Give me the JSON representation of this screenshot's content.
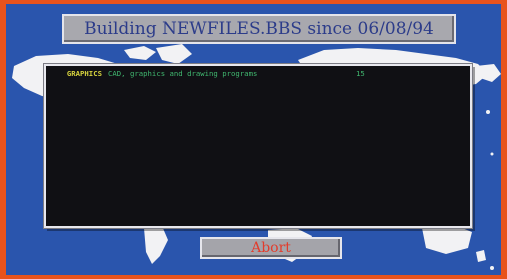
{
  "title": "Building NEWFILES.BBS since 06/08/94",
  "abort_label": "Abort",
  "colors": {
    "border": "#e8531c",
    "background": "#2a55ad",
    "panel": "#101014",
    "area_name": "#d6d23e",
    "area_text": "#40b870",
    "abort_text": "#e23c2c"
  },
  "file_areas": [
    {
      "name": "GRAPHICS",
      "desc": "CAD, graphics and drawing programs",
      "count": "15"
    },
    {
      "name": "",
      "desc": "",
      "count": ""
    },
    {
      "name": "",
      "desc": "",
      "count": ""
    },
    {
      "name": "",
      "desc": "",
      "count": ""
    },
    {
      "name": "",
      "desc": "",
      "count": ""
    },
    {
      "name": "",
      "desc": "",
      "count": ""
    },
    {
      "name": "",
      "desc": "",
      "count": ""
    },
    {
      "name": "",
      "desc": "",
      "count": ""
    },
    {
      "name": "",
      "desc": "",
      "count": ""
    },
    {
      "name": "",
      "desc": "",
      "count": ""
    },
    {
      "name": "",
      "desc": "",
      "count": ""
    },
    {
      "name": "",
      "desc": "",
      "count": ""
    },
    {
      "name": "",
      "desc": "",
      "count": ""
    },
    {
      "name": "",
      "desc": "",
      "count": ""
    },
    {
      "name": "",
      "desc": "",
      "count": ""
    },
    {
      "name": "",
      "desc": "",
      "count": ""
    },
    {
      "name": "",
      "desc": "",
      "count": ""
    },
    {
      "name": "",
      "desc": "",
      "count": ""
    },
    {
      "name": "",
      "desc": "",
      "count": ""
    },
    {
      "name": "",
      "desc": "",
      "count": ""
    }
  ]
}
